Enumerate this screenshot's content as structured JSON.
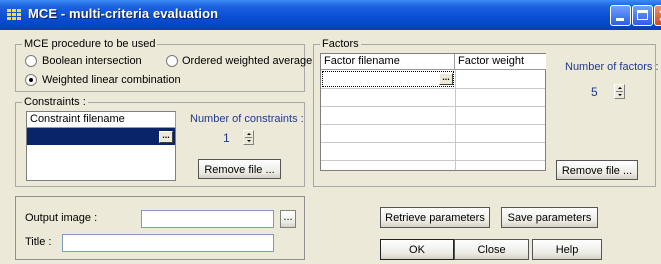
{
  "window": {
    "title": "MCE - multi-criteria evaluation",
    "titlebar_color": "#0a4fd6"
  },
  "procedure": {
    "group_label": "MCE procedure to be used",
    "options": [
      {
        "label": "Boolean intersection",
        "selected": false
      },
      {
        "label": "Ordered weighted average",
        "selected": false
      },
      {
        "label": "Weighted linear combination",
        "selected": true
      }
    ]
  },
  "constraints": {
    "group_label": "Constraints :",
    "column_header": "Constraint filename",
    "selected_row_color": "#0a246a",
    "count_label": "Number of constraints :",
    "count_value": "1",
    "remove_button": "Remove file ..."
  },
  "factors": {
    "group_label": "Factors",
    "columns": [
      "Factor filename",
      "Factor weight"
    ],
    "count_label": "Number of factors :",
    "count_value": "5",
    "remove_button": "Remove file ..."
  },
  "output": {
    "image_label": "Output image :",
    "image_value": "",
    "title_label": "Title :",
    "title_value": ""
  },
  "buttons": {
    "retrieve": "Retrieve parameters",
    "save": "Save parameters",
    "ok": "OK",
    "close": "Close",
    "help": "Help",
    "browse": "..."
  }
}
